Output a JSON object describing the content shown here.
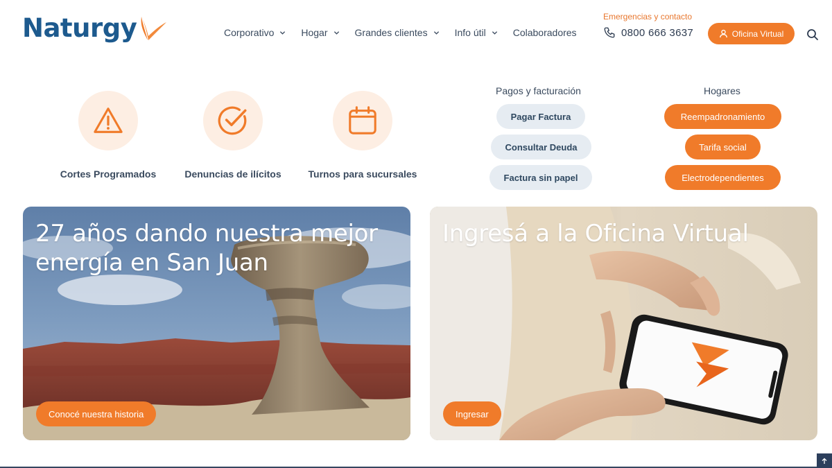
{
  "brand": {
    "logo_text": "Naturgy",
    "accent": "#f07b2a",
    "logo_blue": "#1d5a8e"
  },
  "nav": {
    "items": [
      {
        "label": "Corporativo",
        "has_dropdown": true
      },
      {
        "label": "Hogar",
        "has_dropdown": true
      },
      {
        "label": "Grandes clientes",
        "has_dropdown": true
      },
      {
        "label": "Info útil",
        "has_dropdown": true
      },
      {
        "label": "Colaboradores",
        "has_dropdown": false
      }
    ]
  },
  "contact": {
    "emergency_label": "Emergencias y contacto",
    "phone": "0800 666 3637",
    "phone_icon": "phone-icon"
  },
  "oficina_button": {
    "label": "Oficina Virtual",
    "icon": "user-icon"
  },
  "search": {
    "icon": "search-icon"
  },
  "quick_links": [
    {
      "label": "Cortes Programados",
      "icon": "warning-icon"
    },
    {
      "label": "Denuncias de ilícitos",
      "icon": "check-circle-icon"
    },
    {
      "label": "Turnos para sucursales",
      "icon": "calendar-icon"
    }
  ],
  "pagos": {
    "title": "Pagos y facturación",
    "buttons": [
      "Pagar Factura",
      "Consultar Deuda",
      "Factura sin papel"
    ]
  },
  "hogares": {
    "title": "Hogares",
    "buttons": [
      "Reempadronamiento",
      "Tarifa social",
      "Electrodependientes"
    ]
  },
  "cards": [
    {
      "title_line1": "27 años dando nuestra mejor",
      "title_line2": "energía en San Juan",
      "button": "Conocé nuestra historia"
    },
    {
      "title_line1": "Ingresá a la Oficina Virtual",
      "button": "Ingresar"
    }
  ],
  "scroll_top": {
    "icon": "arrow-up-icon"
  }
}
